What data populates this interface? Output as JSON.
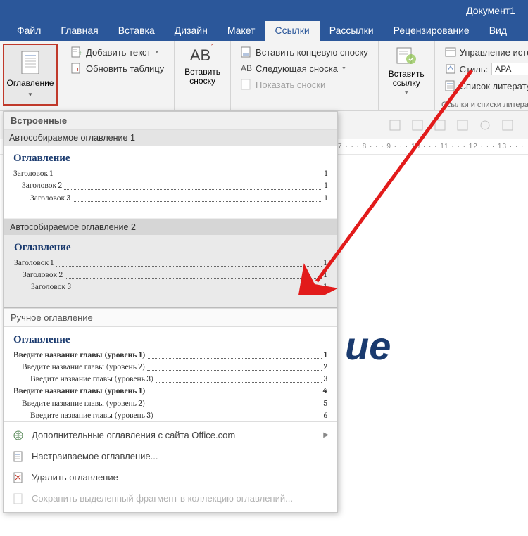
{
  "titlebar": {
    "doc_name": "Документ1"
  },
  "tabs": [
    "Файл",
    "Главная",
    "Вставка",
    "Дизайн",
    "Макет",
    "Ссылки",
    "Рассылки",
    "Рецензирование",
    "Вид"
  ],
  "active_tab_index": 5,
  "ribbon": {
    "toc_button": "Оглавление",
    "add_text": "Добавить текст",
    "update_table": "Обновить таблицу",
    "insert_footnote": "Вставить\nсноску",
    "insert_endnote": "Вставить концевую сноску",
    "next_footnote": "Следующая сноска",
    "show_notes": "Показать сноски",
    "insert_link": "Вставить\nссылку",
    "manage_sources": "Управление источ",
    "style_label": "Стиль:",
    "style_value": "APA",
    "bibliography": "Список литературы",
    "group_label": "Ссылки и списки литературы"
  },
  "ruler_text": "7 · · · 8 · · · 9 · · · 10 · · · 11 · · · 12 · · · 13 · · ·",
  "doc_fragment": "ие",
  "dropdown": {
    "builtin_label": "Встроенные",
    "item1_title": "Автособираемое оглавление 1",
    "item2_title": "Автособираемое оглавление 2",
    "manual_label": "Ручное оглавление",
    "preview_title": "Оглавление",
    "auto_lines": [
      {
        "label": "Заголовок 1",
        "page": "1",
        "indent": 0
      },
      {
        "label": "Заголовок 2",
        "page": "1",
        "indent": 1
      },
      {
        "label": "Заголовок 3",
        "page": "1",
        "indent": 2
      }
    ],
    "manual_lines": [
      {
        "label": "Введите название главы (уровень 1)",
        "page": "1",
        "indent": 0,
        "bold": true
      },
      {
        "label": "Введите название главы (уровень 2)",
        "page": "2",
        "indent": 1
      },
      {
        "label": "Введите название главы (уровень 3)",
        "page": "3",
        "indent": 2
      },
      {
        "label": "Введите название главы (уровень 1)",
        "page": "4",
        "indent": 0,
        "bold": true
      },
      {
        "label": "Введите название главы (уровень 2)",
        "page": "5",
        "indent": 1
      },
      {
        "label": "Введите название главы (уровень 3)",
        "page": "6",
        "indent": 2
      }
    ],
    "menu": {
      "more_from_office": "Дополнительные оглавления с сайта Office.com",
      "custom": "Настраиваемое оглавление...",
      "remove": "Удалить оглавление",
      "save_selection": "Сохранить выделенный фрагмент в коллекцию оглавлений..."
    }
  }
}
